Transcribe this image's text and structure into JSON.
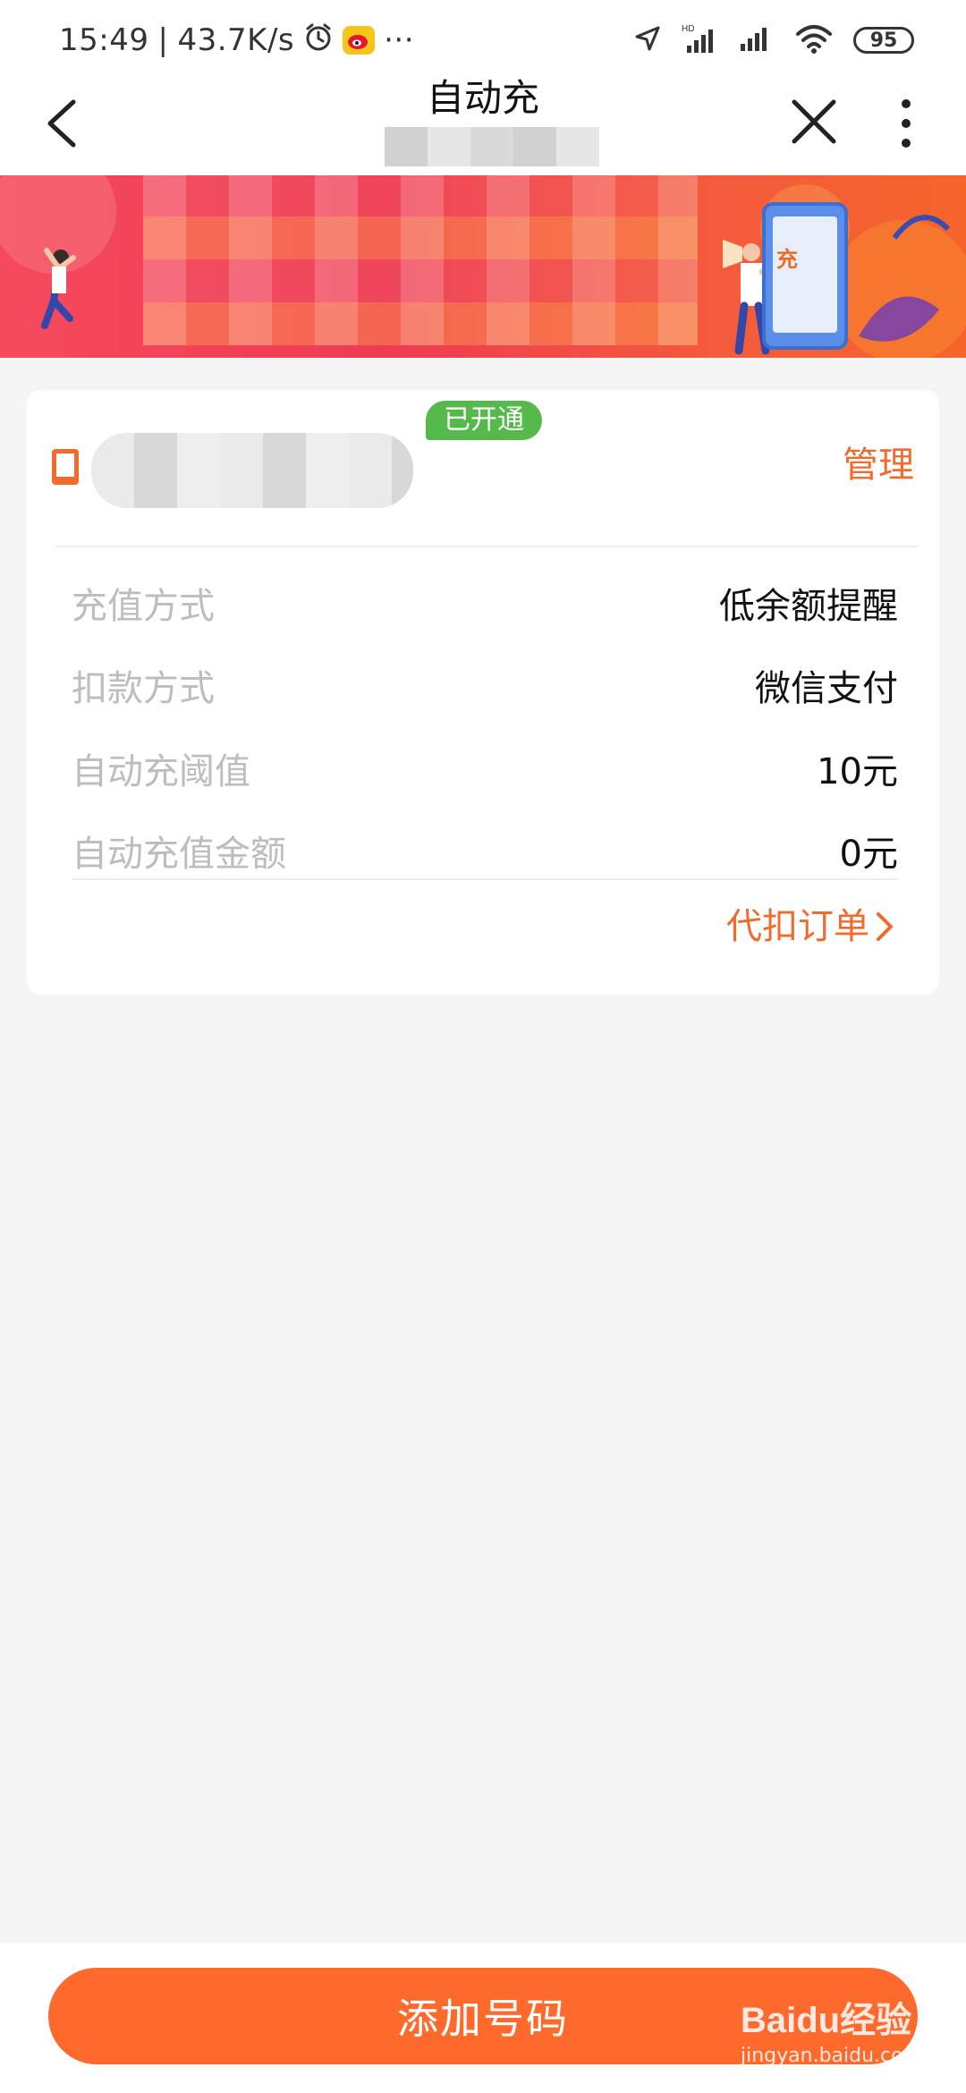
{
  "status_bar": {
    "time": "15:49",
    "separator": "|",
    "net_speed": "43.7K/s",
    "more": "···",
    "battery": "95"
  },
  "nav": {
    "title": "自动充"
  },
  "banner": {
    "phone_label": "充"
  },
  "card": {
    "status_badge": "已开通",
    "manage": "管理",
    "rows": [
      {
        "label": "充值方式",
        "value": "低余额提醒"
      },
      {
        "label": "扣款方式",
        "value": "微信支付"
      },
      {
        "label": "自动充阈值",
        "value": "10元"
      },
      {
        "label": "自动充值金额",
        "value": "0元"
      }
    ],
    "orders_link": "代扣订单"
  },
  "footer": {
    "add_button": "添加号码"
  },
  "watermark": {
    "brand": "Baidu经验",
    "site": "jingyan.baidu.com"
  },
  "colors": {
    "accent": "#fe6a2c",
    "link": "#f06b2d",
    "badge": "#55b94c",
    "background": "#f5f5f5"
  }
}
